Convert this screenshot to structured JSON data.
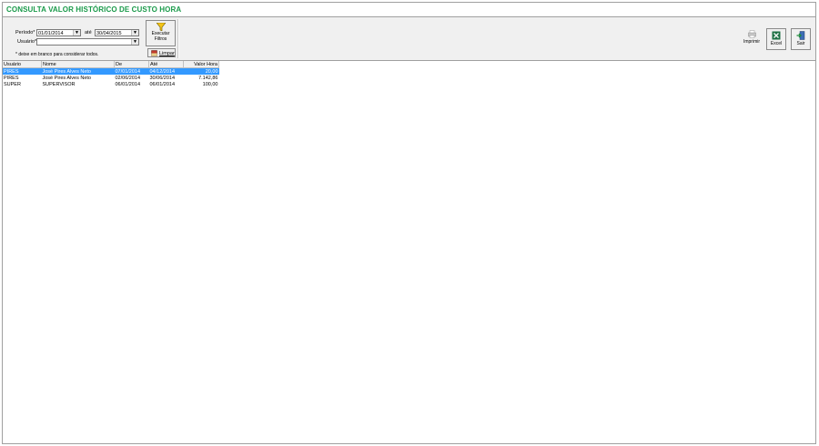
{
  "window": {
    "title": "CONSULTA VALOR HISTÓRICO DE CUSTO HORA"
  },
  "filters": {
    "periodo_label": "Período*",
    "periodo_start": "01/01/2014",
    "ate_label": "até",
    "periodo_end": "30/04/2015",
    "usuario_label": "Usuário*",
    "usuario_value": "",
    "hint": "* deixe em branco para considerar todos."
  },
  "buttons": {
    "executar_line1": "Executar",
    "executar_line2": "Filtros",
    "limpar": "Limpar"
  },
  "toolbar": {
    "imprimir": "Imprimir",
    "excel": "Excel",
    "sair": "Sair"
  },
  "table": {
    "headers": [
      "Usuário",
      "Nome",
      "De",
      "Até",
      "Valor Hora"
    ],
    "rows": [
      [
        "PIRES",
        "José Pires Alves Neto",
        "07/01/2014",
        "04/12/2014",
        "20,00"
      ],
      [
        "PIRES",
        "José Pires Alves Neto",
        "02/06/2014",
        "30/06/2014",
        "7.142,86"
      ],
      [
        "SUPER",
        "SUPERVISOR",
        "06/01/2014",
        "06/01/2014",
        "100,00"
      ]
    ]
  },
  "colors": {
    "title": "#1a9a4a",
    "selection": "#3399ff",
    "panel": "#f0f0f0"
  }
}
